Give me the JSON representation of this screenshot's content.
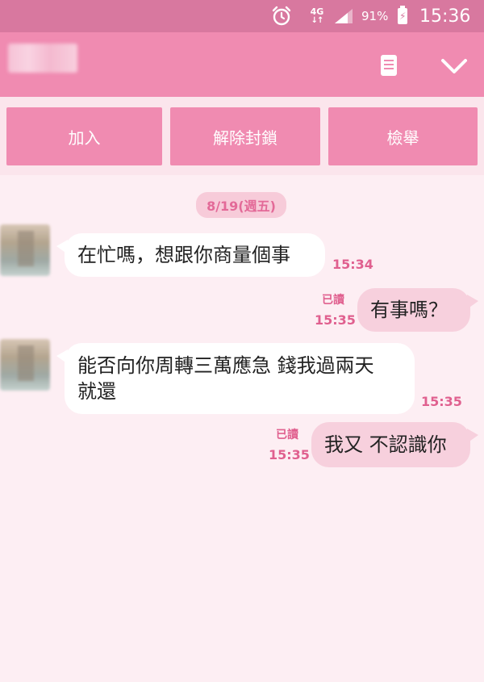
{
  "status_bar": {
    "network": "4G",
    "battery_percent": "91%",
    "time": "15:36",
    "icons": [
      "alarm-icon",
      "signal-icon",
      "battery-charging-icon"
    ],
    "color": "#d8789f"
  },
  "header": {
    "contact_name": "",
    "icons": [
      "note-icon",
      "chevron-down-icon"
    ],
    "color": "#f08bb1"
  },
  "actions": {
    "add_label": "加入",
    "unblock_label": "解除封鎖",
    "report_label": "檢舉"
  },
  "chat": {
    "date": "8/19(週五)",
    "messages": [
      {
        "direction": "incoming",
        "text": "在忙嗎，想跟你商量個事",
        "time": "15:34"
      },
      {
        "direction": "outgoing",
        "text": "有事嗎？",
        "read": "已讀",
        "time": "15:35"
      },
      {
        "direction": "incoming",
        "text_line1": "能否向你周轉三萬應急 錢我過兩天",
        "text_line2": "就還",
        "time": "15:35"
      },
      {
        "direction": "outgoing",
        "text": "我又 不認識你",
        "read": "已讀",
        "time": "15:35"
      }
    ]
  }
}
